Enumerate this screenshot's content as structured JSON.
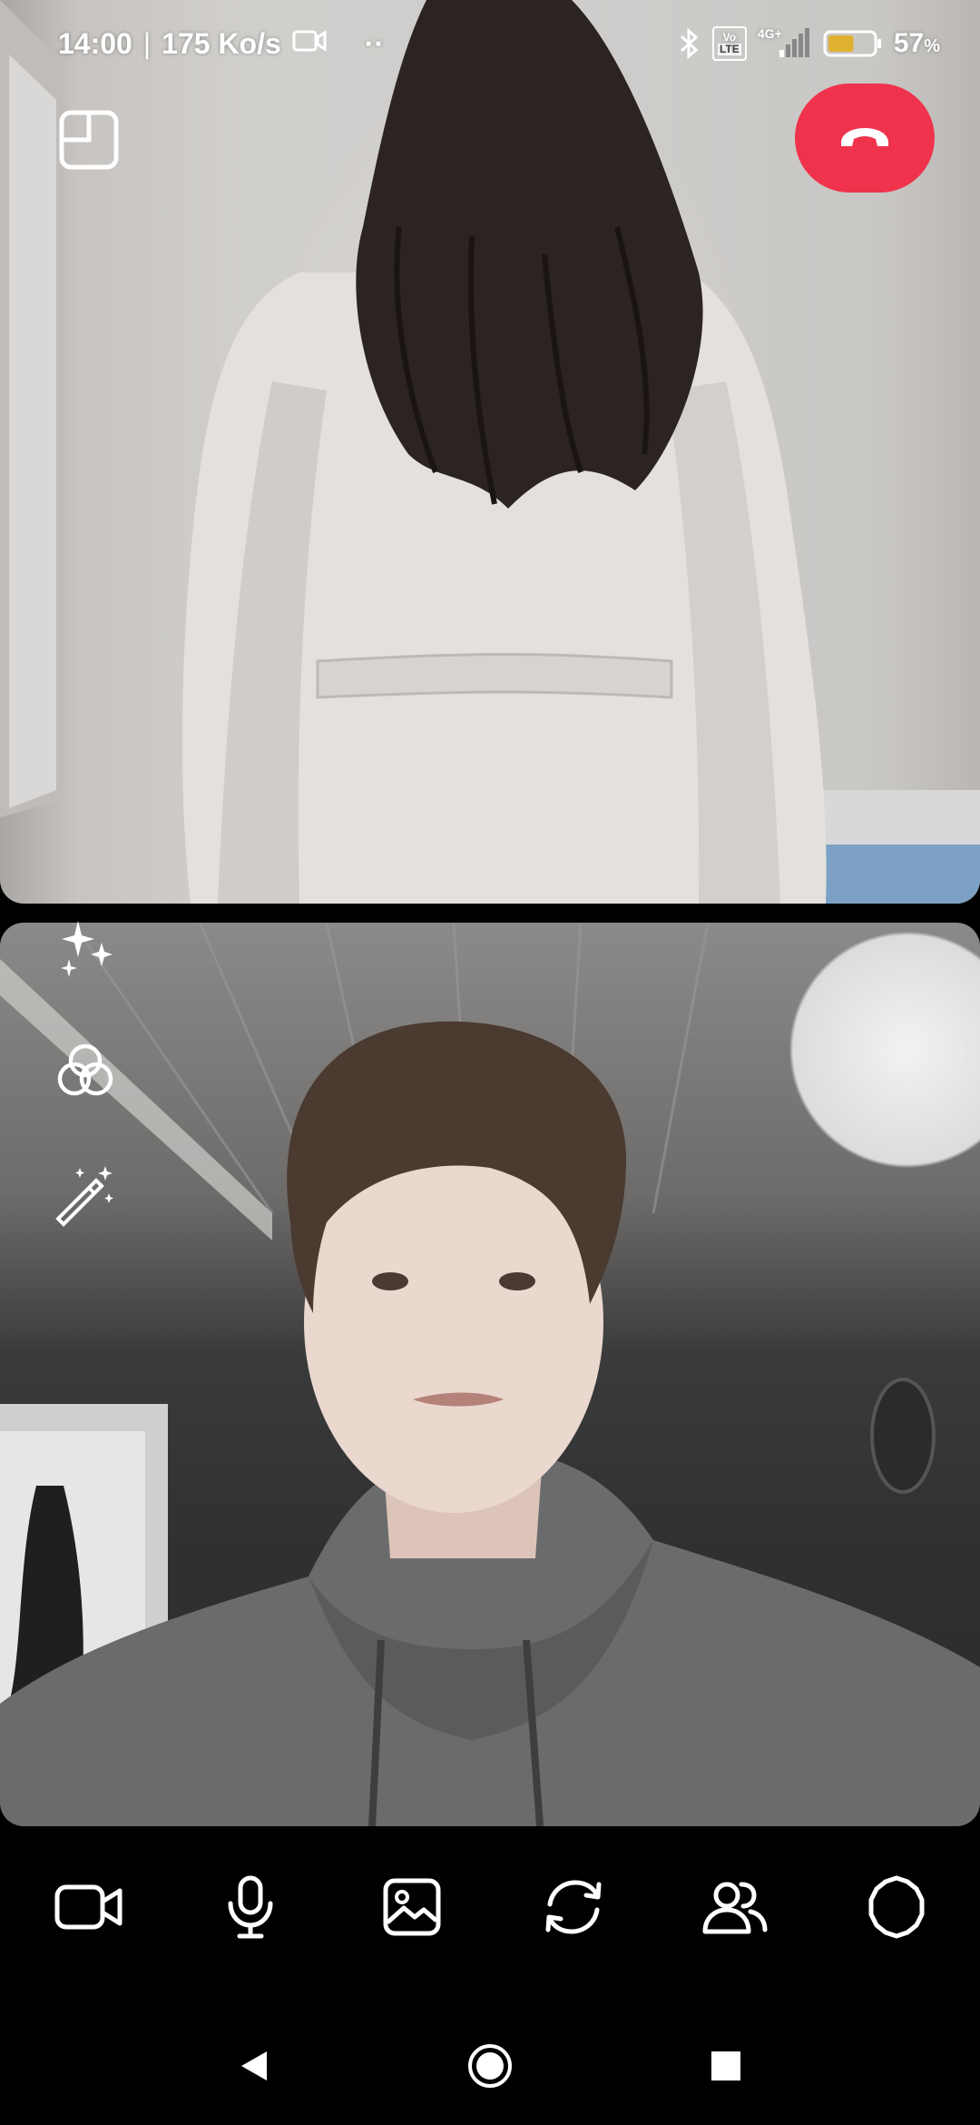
{
  "status_bar": {
    "time": "14:00",
    "separator": "|",
    "net_speed": "175 Ko/s",
    "more_indicator": "··",
    "volte_top": "Vo",
    "volte_bottom": "LTE",
    "network_type": "4G+",
    "battery_percent": "57",
    "battery_unit": "%",
    "battery_level": 0.57,
    "icons": [
      "screen-record-icon",
      "bluetooth-icon",
      "volte-icon",
      "signal-icon",
      "battery-icon"
    ]
  },
  "call": {
    "pip_icon": "picture-in-picture-icon",
    "end_call_icon": "hang-up-icon",
    "end_call_color": "#f0334d",
    "remote_video": "remote-participant-video",
    "local_video": "self-view-video"
  },
  "side_tools": [
    "effects-sparkle-icon",
    "filters-icon",
    "magic-wand-icon"
  ],
  "controls": [
    "camera-icon",
    "microphone-icon",
    "image-icon",
    "flip-camera-icon",
    "participants-icon",
    "settings-icon"
  ],
  "nav": [
    "back-icon",
    "home-icon",
    "recents-icon"
  ]
}
